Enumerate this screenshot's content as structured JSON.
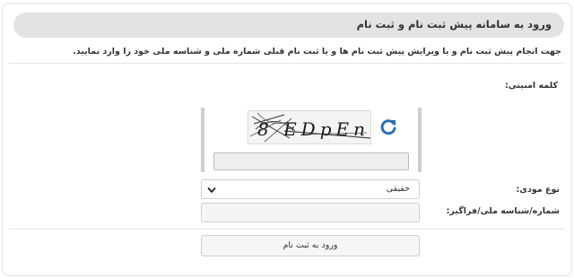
{
  "header": {
    "title": "ورود به سامانه پیش ثبت نام و ثبت نام"
  },
  "intro": {
    "text": "جهت انجام پیش ثبت نام و یا ویرایش پیش ثبت نام ها و یا ثبت نام قبلی شماره ملی و شناسه ملی خود را وارد نمایید."
  },
  "form": {
    "captcha_label": "کلمه امنیتی:",
    "captcha_text": "8 EDpEn",
    "captcha_input_value": "",
    "taxpayer_type_label": "نوع مودی:",
    "taxpayer_type_value": "حقیقی",
    "id_label": "شماره/شناسه ملی/فراگیر:",
    "id_input_value": "",
    "submit_label": "ورود به ثبت نام"
  },
  "icons": {
    "refresh": "refresh-icon",
    "dropdown": "chevron-down-icon"
  },
  "colors": {
    "header_bg": "#e3e3e3",
    "refresh_blue": "#2f6fb3",
    "border": "#cfcfcf"
  }
}
